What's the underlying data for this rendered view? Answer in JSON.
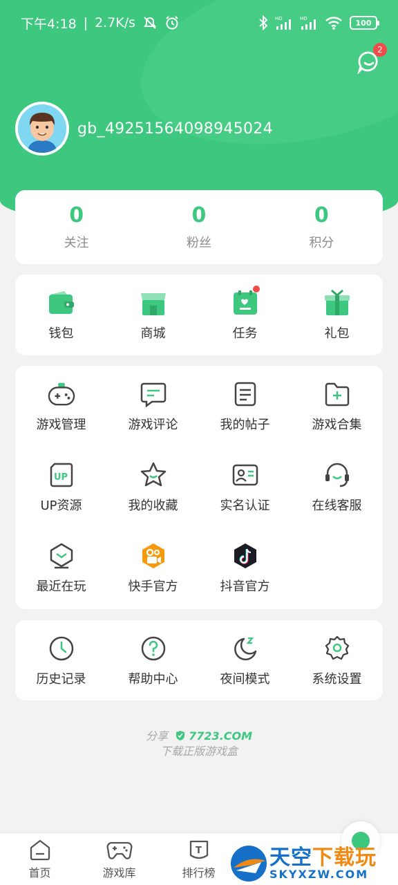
{
  "status_bar": {
    "time": "下午4:18",
    "speed": "2.7K/s",
    "battery": "100"
  },
  "messages": {
    "badge": "2"
  },
  "profile": {
    "username": "gb_49251564098945024"
  },
  "stats": [
    {
      "value": "0",
      "label": "关注"
    },
    {
      "value": "0",
      "label": "粉丝"
    },
    {
      "value": "0",
      "label": "积分"
    }
  ],
  "wallet_row": [
    {
      "label": "钱包",
      "icon": "wallet-icon"
    },
    {
      "label": "商城",
      "icon": "shop-icon"
    },
    {
      "label": "任务",
      "icon": "task-icon"
    },
    {
      "label": "礼包",
      "icon": "gift-icon"
    }
  ],
  "tools": [
    {
      "label": "游戏管理",
      "icon": "gamepad-icon"
    },
    {
      "label": "游戏评论",
      "icon": "comment-icon"
    },
    {
      "label": "我的帖子",
      "icon": "post-icon"
    },
    {
      "label": "游戏合集",
      "icon": "collection-icon"
    },
    {
      "label": "UP资源",
      "icon": "up-icon"
    },
    {
      "label": "我的收藏",
      "icon": "star-icon"
    },
    {
      "label": "实名认证",
      "icon": "idcard-icon"
    },
    {
      "label": "在线客服",
      "icon": "headset-icon"
    },
    {
      "label": "最近在玩",
      "icon": "recent-icon"
    },
    {
      "label": "快手官方",
      "icon": "kuaishou-icon"
    },
    {
      "label": "抖音官方",
      "icon": "douyin-icon"
    }
  ],
  "up_icon_text": "UP",
  "settings_row": [
    {
      "label": "历史记录",
      "icon": "clock-icon"
    },
    {
      "label": "帮助中心",
      "icon": "help-icon"
    },
    {
      "label": "夜间模式",
      "icon": "moon-icon"
    },
    {
      "label": "系统设置",
      "icon": "gear-icon"
    }
  ],
  "share": {
    "prefix": "分享",
    "brand": "7723.COM",
    "tagline": "下载正版游戏盒"
  },
  "bottom_nav": [
    {
      "label": "首页",
      "icon": "home-icon"
    },
    {
      "label": "游戏库",
      "icon": "controller-icon"
    },
    {
      "label": "排行榜",
      "icon": "ranking-icon"
    }
  ],
  "ranking_icon_text": "T",
  "watermark": {
    "title_a": "天空",
    "title_b": "下载玩",
    "sub": "SKYXZW.COM"
  },
  "colors": {
    "brand_green": "#3ec77f",
    "badge_red": "#f24b4b"
  }
}
